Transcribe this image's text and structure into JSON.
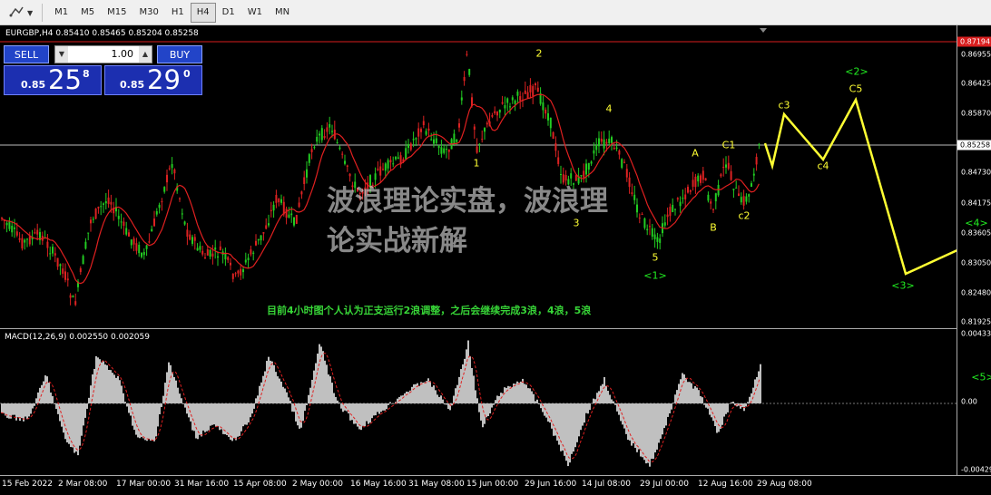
{
  "toolbar": {
    "tool_icon": "cursor-line-tools-icon",
    "timeframes": [
      {
        "label": "M1",
        "active": false
      },
      {
        "label": "M5",
        "active": false
      },
      {
        "label": "M15",
        "active": false
      },
      {
        "label": "M30",
        "active": false
      },
      {
        "label": "H1",
        "active": false
      },
      {
        "label": "H4",
        "active": true
      },
      {
        "label": "D1",
        "active": false
      },
      {
        "label": "W1",
        "active": false
      },
      {
        "label": "MN",
        "active": false
      }
    ]
  },
  "chart": {
    "symbol_info": "EURGBP,H4  0.85410 0.85465 0.85204 0.85258",
    "trade_panel": {
      "sell_label": "SELL",
      "buy_label": "BUY",
      "lot": "1.00",
      "sell_prefix": "0.85",
      "sell_big": "25",
      "sell_sup": "8",
      "buy_prefix": "0.85",
      "buy_big": "29",
      "buy_sup": "0"
    },
    "watermark": {
      "line1": "波浪理论实盘，波浪理",
      "line2": "论实战新解"
    },
    "note": "目前4小时图个人认为正支运行2浪调整，之后会继续完成3浪，4浪，5浪",
    "wave_labels": [
      {
        "text": "1",
        "color": "yellow"
      },
      {
        "text": "2",
        "color": "yellow"
      },
      {
        "text": "3",
        "color": "yellow"
      },
      {
        "text": "4",
        "color": "yellow"
      },
      {
        "text": "5",
        "color": "yellow"
      },
      {
        "text": "<1>",
        "color": "green"
      },
      {
        "text": "A",
        "color": "yellow"
      },
      {
        "text": "B",
        "color": "yellow"
      },
      {
        "text": "C1",
        "color": "yellow"
      },
      {
        "text": "c2",
        "color": "yellow"
      },
      {
        "text": "c3",
        "color": "yellow"
      },
      {
        "text": "c4",
        "color": "yellow"
      },
      {
        "text": "C5",
        "color": "yellow"
      },
      {
        "text": "<2>",
        "color": "green"
      },
      {
        "text": "<3>",
        "color": "green"
      },
      {
        "text": "<4>",
        "color": "green"
      },
      {
        "text": "<5>",
        "color": "green"
      }
    ],
    "price_axis": [
      "0.86955",
      "0.86425",
      "0.85870",
      "0.84730",
      "0.84175",
      "0.83605",
      "0.83050",
      "0.82480",
      "0.81925"
    ],
    "price_tags": {
      "top_red": "0.87194",
      "current": "0.85258"
    },
    "macd_info": "MACD(12,26,9) 0.002550 0.002059",
    "macd_axis": [
      "0.00433",
      "0.00",
      "-0.00429"
    ],
    "time_axis": [
      "15 Feb 2022",
      "2 Mar 08:00",
      "17 Mar 00:00",
      "31 Mar 16:00",
      "15 Apr 08:00",
      "2 May 00:00",
      "16 May 16:00",
      "31 May 08:00",
      "15 Jun 00:00",
      "29 Jun 16:00",
      "14 Jul 08:00",
      "29 Jul 00:00",
      "12 Aug 16:00",
      "29 Aug 08:00"
    ],
    "colors": {
      "bull_candle": "#22cc22",
      "bear_candle": "#dd2222",
      "moving_average": "#e02020",
      "forecast_line": "#ffff33",
      "macd_histogram": "#c0c0c0",
      "macd_signal": "#e02020",
      "wave_yellow": "#ffff33",
      "wave_green": "#22ee22"
    }
  }
}
